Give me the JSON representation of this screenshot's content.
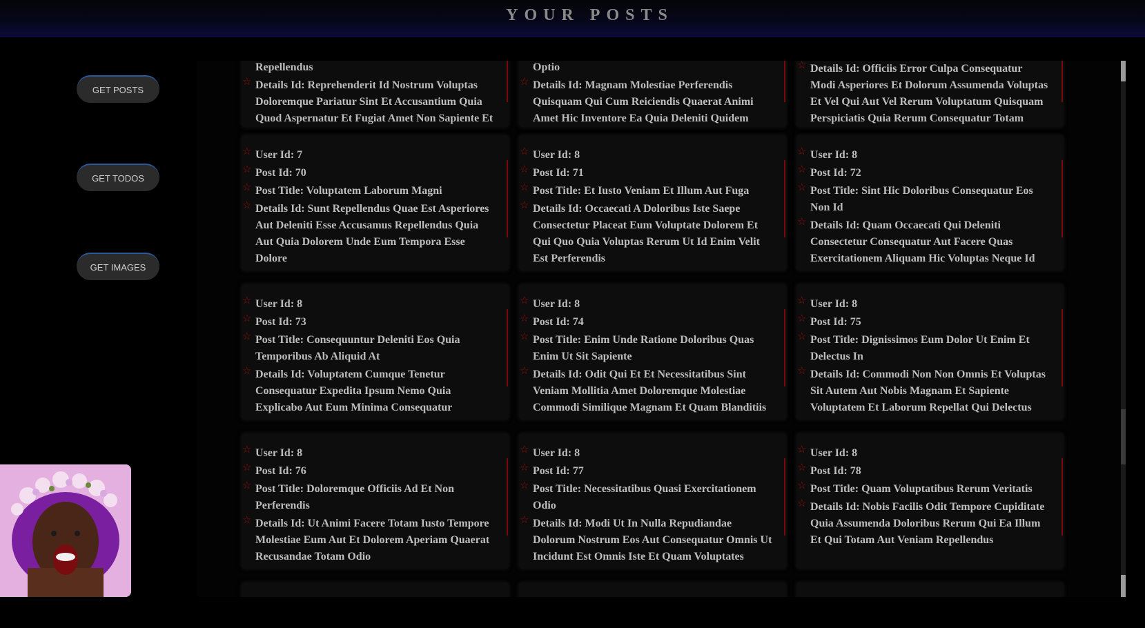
{
  "header": {
    "title": "YOUR POSTS"
  },
  "sidebar": {
    "buttons": [
      {
        "label": "GET POSTS"
      },
      {
        "label": "GET TODOS"
      },
      {
        "label": "GET IMAGES"
      }
    ],
    "avatar_alt": "profile image"
  },
  "posts": {
    "partial_top": [
      {
        "line1": "Repellendus",
        "details": "Details Id: Reprehenderit Id Nostrum Voluptas Doloremque Pariatur Sint Et Accusantium Quia Quod Aspernatur Et Fugiat Amet Non Sapiente Et"
      },
      {
        "line1": "Optio",
        "details": "Details Id: Magnam Molestiae Perferendis Quisquam Qui Cum Reiciendis Quaerat Animi Amet Hic Inventore Ea Quia Deleniti Quidem"
      },
      {
        "line1": "Details Id: Officiis Error Culpa Consequatur",
        "details": "Modi Asperiores Et Dolorum Assumenda Voluptas Et Vel Qui Aut Vel Rerum Voluptatum Quisquam Perspiciatis Quia Rerum Consequatur Totam"
      }
    ],
    "items": [
      {
        "user": "User Id: 7",
        "post": "Post Id: 70",
        "title": "Post Title: Voluptatem Laborum Magni",
        "details": "Details Id: Sunt Repellendus Quae Est Asperiores Aut Deleniti Esse Accusamus Repellendus Quia Aut Quia Dolorem Unde Eum Tempora Esse Dolore"
      },
      {
        "user": "User Id: 8",
        "post": "Post Id: 71",
        "title": "Post Title: Et Iusto Veniam Et Illum Aut Fuga",
        "details": "Details Id: Occaecati A Doloribus Iste Saepe Consectetur Placeat Eum Voluptate Dolorem Et Qui Quo Quia Voluptas Rerum Ut Id Enim Velit Est Perferendis"
      },
      {
        "user": "User Id: 8",
        "post": "Post Id: 72",
        "title": "Post Title: Sint Hic Doloribus Consequatur Eos Non Id",
        "details": "Details Id: Quam Occaecati Qui Deleniti Consectetur Consequatur Aut Facere Quas Exercitationem Aliquam Hic Voluptas Neque Id"
      },
      {
        "user": "User Id: 8",
        "post": "Post Id: 73",
        "title": "Post Title: Consequuntur Deleniti Eos Quia Temporibus Ab Aliquid At",
        "details": "Details Id: Voluptatem Cumque Tenetur Consequatur Expedita Ipsum Nemo Quia Explicabo Aut Eum Minima Consequatur"
      },
      {
        "user": "User Id: 8",
        "post": "Post Id: 74",
        "title": "Post Title: Enim Unde Ratione Doloribus Quas Enim Ut Sit Sapiente",
        "details": "Details Id: Odit Qui Et Et Necessitatibus Sint Veniam Mollitia Amet Doloremque Molestiae Commodi Similique Magnam Et Quam Blanditiis"
      },
      {
        "user": "User Id: 8",
        "post": "Post Id: 75",
        "title": "Post Title: Dignissimos Eum Dolor Ut Enim Et Delectus In",
        "details": "Details Id: Commodi Non Non Omnis Et Voluptas Sit Autem Aut Nobis Magnam Et Sapiente Voluptatem Et Laborum Repellat Qui Delectus"
      },
      {
        "user": "User Id: 8",
        "post": "Post Id: 76",
        "title": "Post Title: Doloremque Officiis Ad Et Non Perferendis",
        "details": "Details Id: Ut Animi Facere Totam Iusto Tempore Molestiae Eum Aut Et Dolorem Aperiam Quaerat Recusandae Totam Odio"
      },
      {
        "user": "User Id: 8",
        "post": "Post Id: 77",
        "title": "Post Title: Necessitatibus Quasi Exercitationem Odio",
        "details": "Details Id: Modi Ut In Nulla Repudiandae Dolorum Nostrum Eos Aut Consequatur Omnis Ut Incidunt Est Omnis Iste Et Quam Voluptates"
      },
      {
        "user": "User Id: 8",
        "post": "Post Id: 78",
        "title": "Post Title: Quam Voluptatibus Rerum Veritatis",
        "details": "Details Id: Nobis Facilis Odit Tempore Cupiditate Quia Assumenda Doloribus Rerum Qui Ea Illum Et Qui Totam Aut Veniam Repellendus"
      }
    ]
  },
  "colors": {
    "accent_star": "#9c0c0c",
    "accent_bar": "#7d0a0a",
    "button_border": "#2a5a9a"
  },
  "icons": {
    "bullet": "star-icon"
  }
}
